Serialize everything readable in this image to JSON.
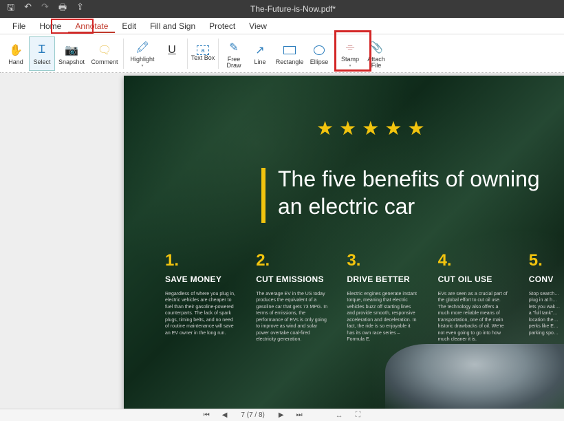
{
  "titlebar": {
    "doctitle": "The-Future-is-Now.pdf*",
    "quick": [
      "save",
      "undo",
      "redo",
      "print",
      "share"
    ]
  },
  "menu": {
    "items": [
      "File",
      "Home",
      "Annotate",
      "Edit",
      "Fill and Sign",
      "Protect",
      "View"
    ],
    "active": "Annotate"
  },
  "tools": {
    "hand": "Hand",
    "select": "Select",
    "snapshot": "Snapshot",
    "comment": "Comment",
    "highlight": "Highlight",
    "textbox": "Text Box",
    "freedraw": "Free Draw",
    "line": "Line",
    "rectangle": "Rectangle",
    "ellipse": "Ellipse",
    "stamp": "Stamp",
    "attach": "Attach File"
  },
  "document": {
    "headline": "The five benefits of owning an electric car",
    "stars": 5,
    "benefits": [
      {
        "num": "1.",
        "title": "SAVE MONEY",
        "text": "Regardless of where you plug in, electric vehicles are cheaper to fuel than their gasoline-powered counterparts. The lack of spark plugs, timing belts, and no need of routine maintenance will save an EV owner in the long run."
      },
      {
        "num": "2.",
        "title": "CUT EMISSIONS",
        "text": "The average EV in the US today produces the equivalent of a gasoline car that gets 73 MPG. In terms of emissions, the performance of EVs is only going to improve as wind and solar power overtake coal-fired electricity generation."
      },
      {
        "num": "3.",
        "title": "DRIVE BETTER",
        "text": "Electric engines generate instant torque, meaning that electric vehicles buzz off starting lines and provide smooth, responsive acceleration and deceleration. In fact, the ride is so enjoyable it has its own race series – Formula E."
      },
      {
        "num": "4.",
        "title": "CUT OIL USE",
        "text": "EVs are seen as a crucial part of the global effort to cut oil use. The technology also offers a much more reliable means of transportation, one of the main historic drawbacks of oil. We're not even going to go into how much cleaner it is."
      },
      {
        "num": "5.",
        "title": "CONV",
        "text": "Stop search… plug in at h… lets you wak… a \"full tank\"… location the… perks like E… parking spo…"
      }
    ]
  },
  "status": {
    "page_current": 7,
    "page_total": 8,
    "page_display": "7 (7 / 8)"
  }
}
